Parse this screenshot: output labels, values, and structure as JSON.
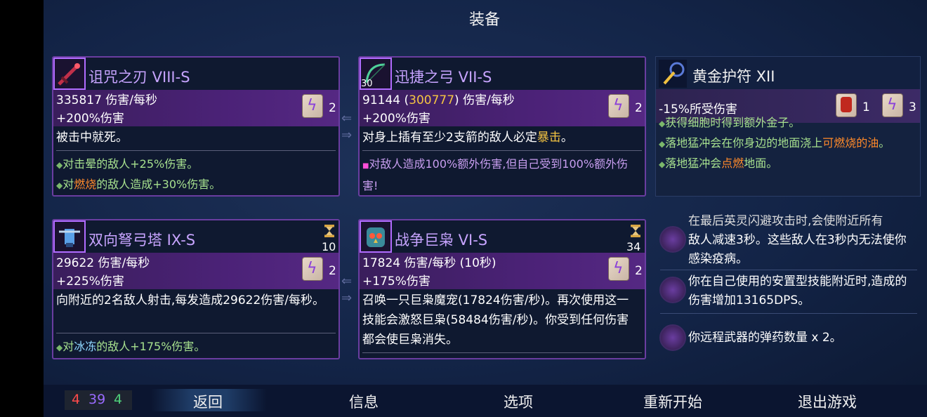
{
  "title": "装备",
  "cards": [
    {
      "name": "诅咒之刃 VIII-S",
      "stat1": "335817 伤害/每秒",
      "stat2": "+200%伤害",
      "scroll_count": "2",
      "desc": "被击中就死。",
      "affix1_pre": "对击晕的敌人+25%伤害。",
      "affix2_pre": "对",
      "affix2_hl": "燃烧",
      "affix2_post": "的敌人造成+30%伤害。"
    },
    {
      "name": "迅捷之弓 VII-S",
      "ammo": "30",
      "stat1_pre": "91144 (",
      "stat1_hl": "300777",
      "stat1_post": ") 伤害/每秒",
      "stat2": "+200%伤害",
      "scroll_count": "2",
      "desc_pre": "对身上插有至少2支箭的敌人必定",
      "desc_hl": "暴击",
      "desc_post": "。",
      "affix1": "对敌人造成100%额外伤害,但自己受到100%额外伤害!"
    },
    {
      "name": "双向弩弓塔 IX-S",
      "cooldown": "10",
      "stat1": "29622 伤害/每秒",
      "stat2": "+225%伤害",
      "scroll_count": "2",
      "desc": "向附近的2名敌人射击,每发造成29622伤害/每秒。",
      "affix1_pre": "对",
      "affix1_hl": "冰冻",
      "affix1_post": "的敌人+175%伤害。"
    },
    {
      "name": "战争巨枭 VI-S",
      "cooldown": "34",
      "stat1": "17824 伤害/每秒 (10秒)",
      "stat2": "+175%伤害",
      "scroll_count": "2",
      "desc": "召唤一只巨枭魔宠(17824伤害/秒)。再次使用这一技能会激怒巨枭(58484伤害/秒)。你受到任何伤害都会使巨枭消失。"
    }
  ],
  "amulet": {
    "name": "黄金护符 XII",
    "stat1": "-15%所受伤害",
    "scroll1_count": "1",
    "scroll2_count": "3",
    "line_cut": "获得细胞时得到额外金子。",
    "line2_pre": "落地猛冲会在你身边的地面浇上",
    "line2_hl": "可燃烧的油",
    "line2_post": "。",
    "line3_pre": "落地猛冲会",
    "line3_hl": "点燃",
    "line3_post": "地面。"
  },
  "skills": [
    {
      "icon": "plague-mutation-icon",
      "text_cut": "在最后英灵闪避攻击时,会使附近所有",
      "text": "敌人减速3秒。这些敌人在3秒内无法使你感染疫病。"
    },
    {
      "icon": "trap-mutation-icon",
      "text": "你在自己使用的安置型技能附近时,造成的伤害增加13165DPS。"
    },
    {
      "icon": "ammo-mutation-icon",
      "text": "你远程武器的弹药数量 x 2。"
    }
  ],
  "counters": {
    "red": "4",
    "purple": "39",
    "green": "4"
  },
  "menu": {
    "back": "返回",
    "info": "信息",
    "options": "选项",
    "restart": "重新开始",
    "quit": "退出游戏"
  },
  "colors": {
    "brutality": "#ff4a4a",
    "tactics": "#9a6bff",
    "survival": "#4fd07a"
  }
}
